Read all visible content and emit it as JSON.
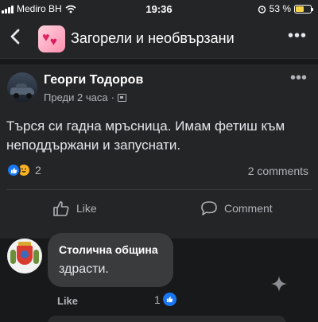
{
  "status_bar": {
    "carrier": "Mediro BH",
    "time": "19:36",
    "battery": "53 %",
    "battery_level": 0.53
  },
  "header": {
    "title": "Загорели и необвързани"
  },
  "post": {
    "author": "Георги Тодоров",
    "time": "Преди 2 часа",
    "separator": "·",
    "text": "Търся си гадна мръсница. Имам фетиш към неподдържани и запуснати.",
    "reactions_count": "2",
    "comments_count": "2 comments",
    "like_label": "Like",
    "comment_label": "Comment"
  },
  "comment": {
    "author": "Столична община",
    "text": "здрасти.",
    "like_label": "Like",
    "reactions_count": "1"
  },
  "colors": {
    "background": "#18191a",
    "surface": "#242526",
    "bubble": "#3a3b3c",
    "like_blue": "#1877f2",
    "haha_yellow": "#f7b125"
  }
}
